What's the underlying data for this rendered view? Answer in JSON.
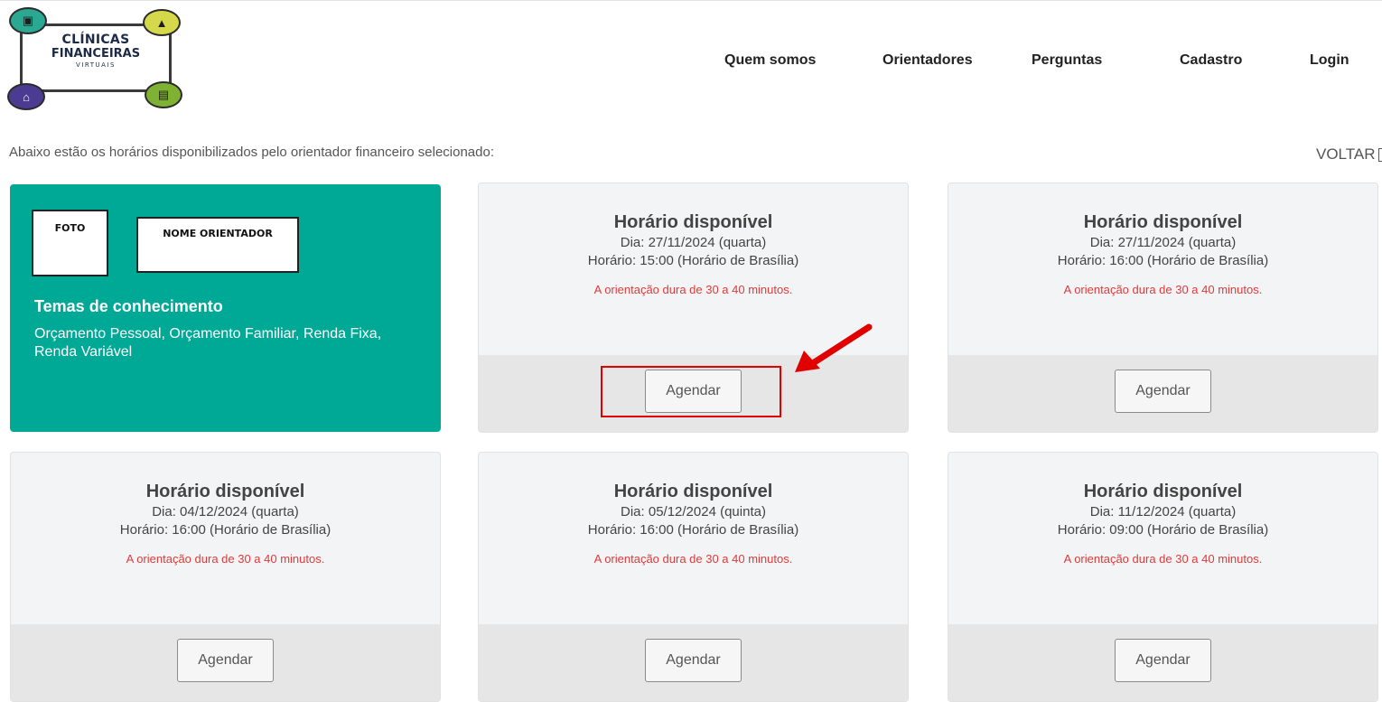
{
  "header": {
    "logo": {
      "line1": "CLÍNICAS",
      "line2": "FINANCEIRAS",
      "line3": "VIRTUAIS"
    },
    "nav": [
      "Quem somos",
      "Orientadores",
      "Perguntas",
      "Cadastro",
      "Login"
    ]
  },
  "intro": "Abaixo estão os horários disponibilizados pelo orientador financeiro selecionado:",
  "back_label": "VOLTAR",
  "profile": {
    "foto_label": "FOTO",
    "nome_label": "NOME ORIENTADOR",
    "temas_title": "Temas de conhecimento",
    "temas_text": "Orçamento Pessoal, Orçamento Familiar, Renda Fixa, Renda Variável"
  },
  "slots": [
    {
      "title": "Horário disponível",
      "day": "Dia: 27/11/2024 (quarta)",
      "time": "Horário: 15:00 (Horário de Brasília)",
      "note": "A orientação dura de 30 a 40 minutos.",
      "button": "Agendar"
    },
    {
      "title": "Horário disponível",
      "day": "Dia: 27/11/2024 (quarta)",
      "time": "Horário: 16:00 (Horário de Brasília)",
      "note": "A orientação dura de 30 a 40 minutos.",
      "button": "Agendar"
    },
    {
      "title": "Horário disponível",
      "day": "Dia: 04/12/2024 (quarta)",
      "time": "Horário: 16:00 (Horário de Brasília)",
      "note": "A orientação dura de 30 a 40 minutos.",
      "button": "Agendar"
    },
    {
      "title": "Horário disponível",
      "day": "Dia: 05/12/2024 (quinta)",
      "time": "Horário: 16:00 (Horário de Brasília)",
      "note": "A orientação dura de 30 a 40 minutos.",
      "button": "Agendar"
    },
    {
      "title": "Horário disponível",
      "day": "Dia: 11/12/2024 (quarta)",
      "time": "Horário: 09:00 (Horário de Brasília)",
      "note": "A orientação dura de 30 a 40 minutos.",
      "button": "Agendar"
    }
  ],
  "colors": {
    "profile_bg": "#00a896",
    "note_red": "#e03a3a",
    "annotation_red": "#e00000"
  }
}
